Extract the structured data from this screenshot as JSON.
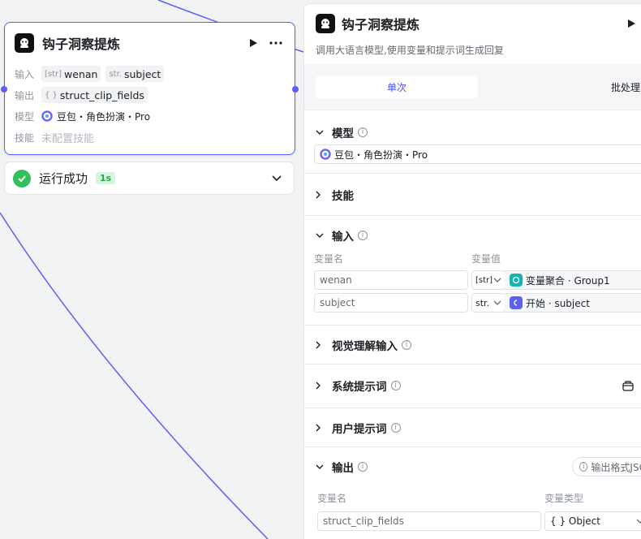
{
  "node": {
    "title": "钩子洞察提炼",
    "input_label": "输入",
    "output_label": "输出",
    "model_label": "模型",
    "skill_label": "技能",
    "inputs": [
      {
        "type": "[str]",
        "name": "wenan"
      },
      {
        "type": "str.",
        "name": "subject"
      }
    ],
    "output": {
      "type": "{ }",
      "name": "struct_clip_fields"
    },
    "model": "豆包・角色扮演・Pro",
    "skill": "未配置技能"
  },
  "run": {
    "status": "运行成功",
    "duration": "1s"
  },
  "panel": {
    "title": "钩子洞察提炼",
    "description": "调用大语言模型,使用变量和提示词生成回复",
    "tabs": [
      {
        "label": "单次",
        "active": true
      },
      {
        "label": "批处理",
        "active": false
      }
    ],
    "sections": {
      "model": {
        "label": "模型",
        "value": "豆包・角色扮演・Pro"
      },
      "skills": {
        "label": "技能"
      },
      "input": {
        "label": "输入",
        "col_name": "变量名",
        "col_value": "变量值",
        "rows": [
          {
            "name": "wenan",
            "type": "[str]",
            "source": "变量聚合 · Group1"
          },
          {
            "name": "subject",
            "type": "str.",
            "source": "开始 · subject"
          }
        ]
      },
      "vision": {
        "label": "视觉理解输入"
      },
      "system_prompt": {
        "label": "系统提示词"
      },
      "user_prompt": {
        "label": "用户提示词"
      },
      "output": {
        "label": "输出",
        "format_button": "输出格式JSON",
        "col_name": "变量名",
        "col_type": "变量类型",
        "row": {
          "name": "struct_clip_fields",
          "type": "{ } Object"
        }
      }
    }
  },
  "colors": {
    "accent": "#5b5ff5",
    "success": "#30c15a",
    "tab_active": "#4d53e8"
  }
}
